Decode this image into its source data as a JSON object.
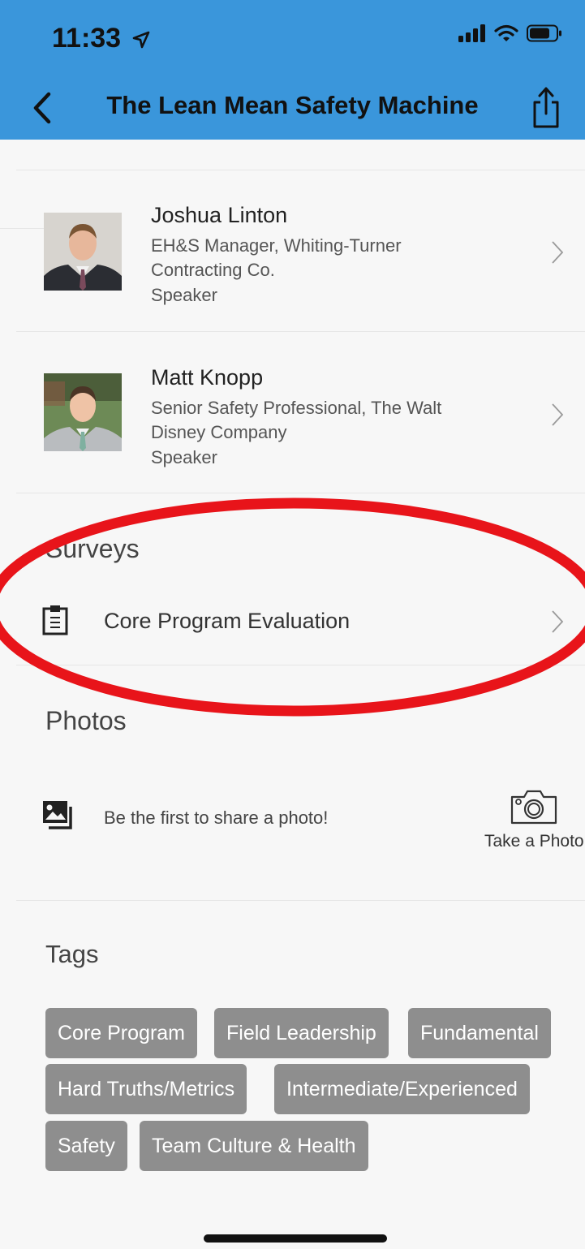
{
  "status_bar": {
    "time": "11:33"
  },
  "nav": {
    "title": "The Lean Mean Safety Machine"
  },
  "speakers": [
    {
      "name": "Joshua Linton",
      "role": "EH&S Manager, Whiting-Turner Contracting Co.",
      "type": "Speaker"
    },
    {
      "name": "Matt Knopp",
      "role": "Senior Safety Professional, The Walt Disney Company",
      "type": "Speaker"
    }
  ],
  "surveys": {
    "title": "Surveys",
    "item_label": "Core Program Evaluation"
  },
  "photos": {
    "title": "Photos",
    "empty_text": "Be the first to share a photo!",
    "take_photo_label": "Take a Photo"
  },
  "tags": {
    "title": "Tags",
    "items": [
      "Core Program",
      "Field Leadership",
      "Fundamental",
      "Hard Truths/Metrics",
      "Intermediate/Experienced",
      "Safety",
      "Team Culture & Health"
    ]
  },
  "colors": {
    "header": "#3a96db",
    "tag_bg": "#8e8e8e",
    "annotation": "#e8141a"
  },
  "icons": [
    "navigation-arrow-icon",
    "signal-icon",
    "wifi-icon",
    "battery-icon",
    "back-chevron-icon",
    "share-icon",
    "chevron-right-icon",
    "clipboard-icon",
    "photo-gallery-icon",
    "camera-icon"
  ]
}
